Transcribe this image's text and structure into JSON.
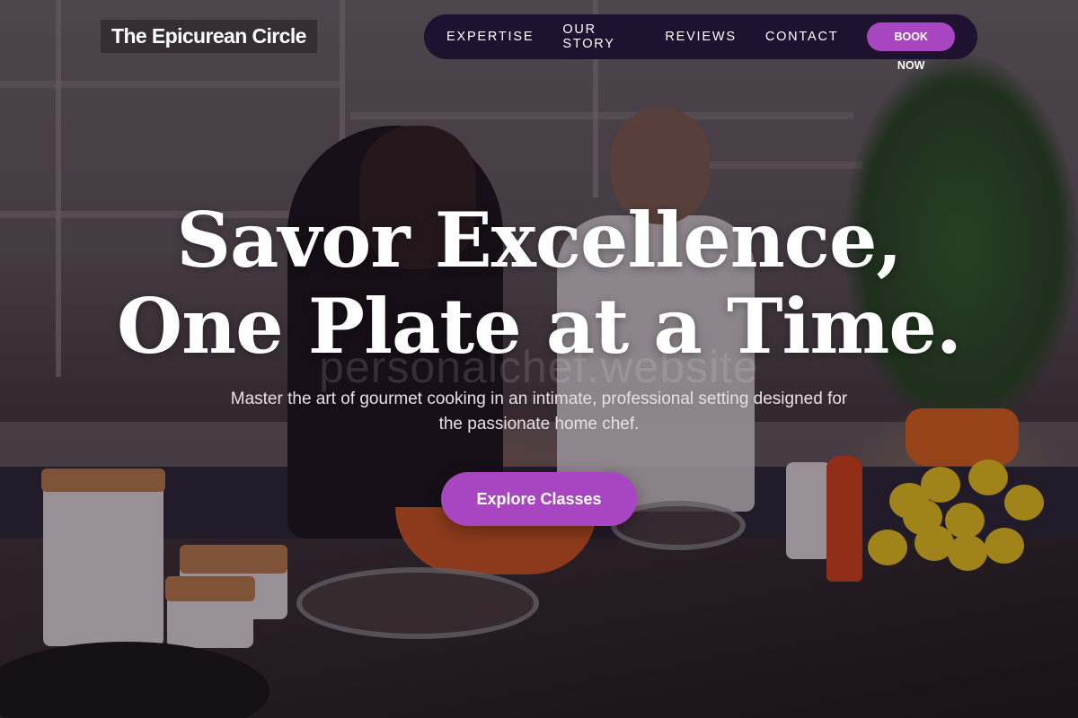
{
  "brand": {
    "name": "The Epicurean Circle"
  },
  "nav": {
    "links": [
      {
        "label": "EXPERTISE"
      },
      {
        "label": "OUR STORY"
      },
      {
        "label": "REVIEWS"
      },
      {
        "label": "CONTACT"
      }
    ],
    "cta_label": "BOOK NOW"
  },
  "hero": {
    "title_line1": "Savor Excellence,",
    "title_line2": "One Plate at a Time.",
    "watermark": "personalchef.website",
    "subtitle": "Master the art of gourmet cooking in an intimate, professional setting designed for the passionate home chef.",
    "cta_label": "Explore Classes"
  },
  "colors": {
    "accent": "#a746c0",
    "nav_background": "#1e1230",
    "text": "#ffffff"
  }
}
